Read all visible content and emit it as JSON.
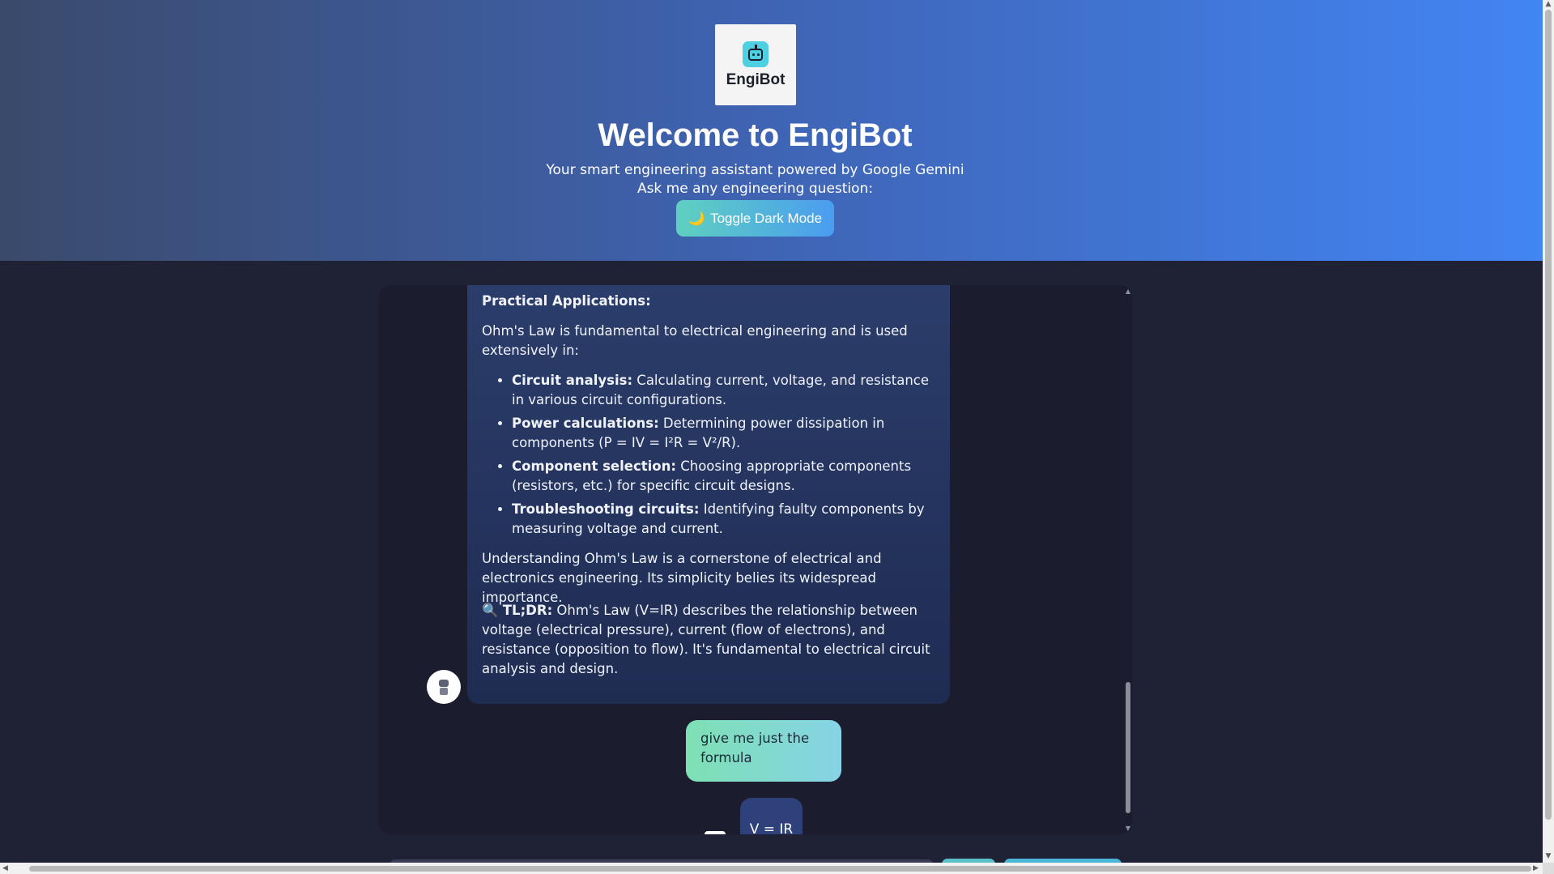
{
  "header": {
    "logo_text": "EngiBot",
    "title": "Welcome to EngiBot",
    "subtitle_line1": "Your smart engineering assistant powered by Google Gemini",
    "subtitle_line2": "Ask me any engineering question:",
    "toggle_icon": "🌙",
    "toggle_label": "Toggle Dark Mode"
  },
  "chat": {
    "bot_message": {
      "heading": "Practical Applications:",
      "intro": "Ohm's Law is fundamental to electrical engineering and is used extensively in:",
      "bullets": [
        {
          "title": "Circuit analysis:",
          "text": " Calculating current, voltage, and resistance in various circuit configurations."
        },
        {
          "title": "Power calculations:",
          "text": " Determining power dissipation in components (P = IV = I²R = V²/R)."
        },
        {
          "title": "Component selection:",
          "text": " Choosing appropriate components (resistors, etc.) for specific circuit designs."
        },
        {
          "title": "Troubleshooting circuits:",
          "text": " Identifying faulty components by measuring voltage and current."
        }
      ],
      "understanding": "Understanding Ohm's Law is a cornerstone of electrical and electronics engineering. Its simplicity belies its widespread importance.",
      "tldr_icon": "🔍",
      "tldr_label": "TL;DR:",
      "tldr_text": " Ohm's Law (V=IR) describes the relationship between voltage (electrical pressure), current (flow of electrons), and resistance (opposition to flow). It's fundamental to electrical circuit analysis and design."
    },
    "user_message": "give me just the formula",
    "bot_answer": "V = IR"
  },
  "colors": {
    "header_start": "#3a4a6b",
    "header_end": "#4285f4",
    "page_bg": "#1f2235",
    "bot_bubble": "#2b3d6b",
    "user_bubble": "#7ee0b4"
  }
}
